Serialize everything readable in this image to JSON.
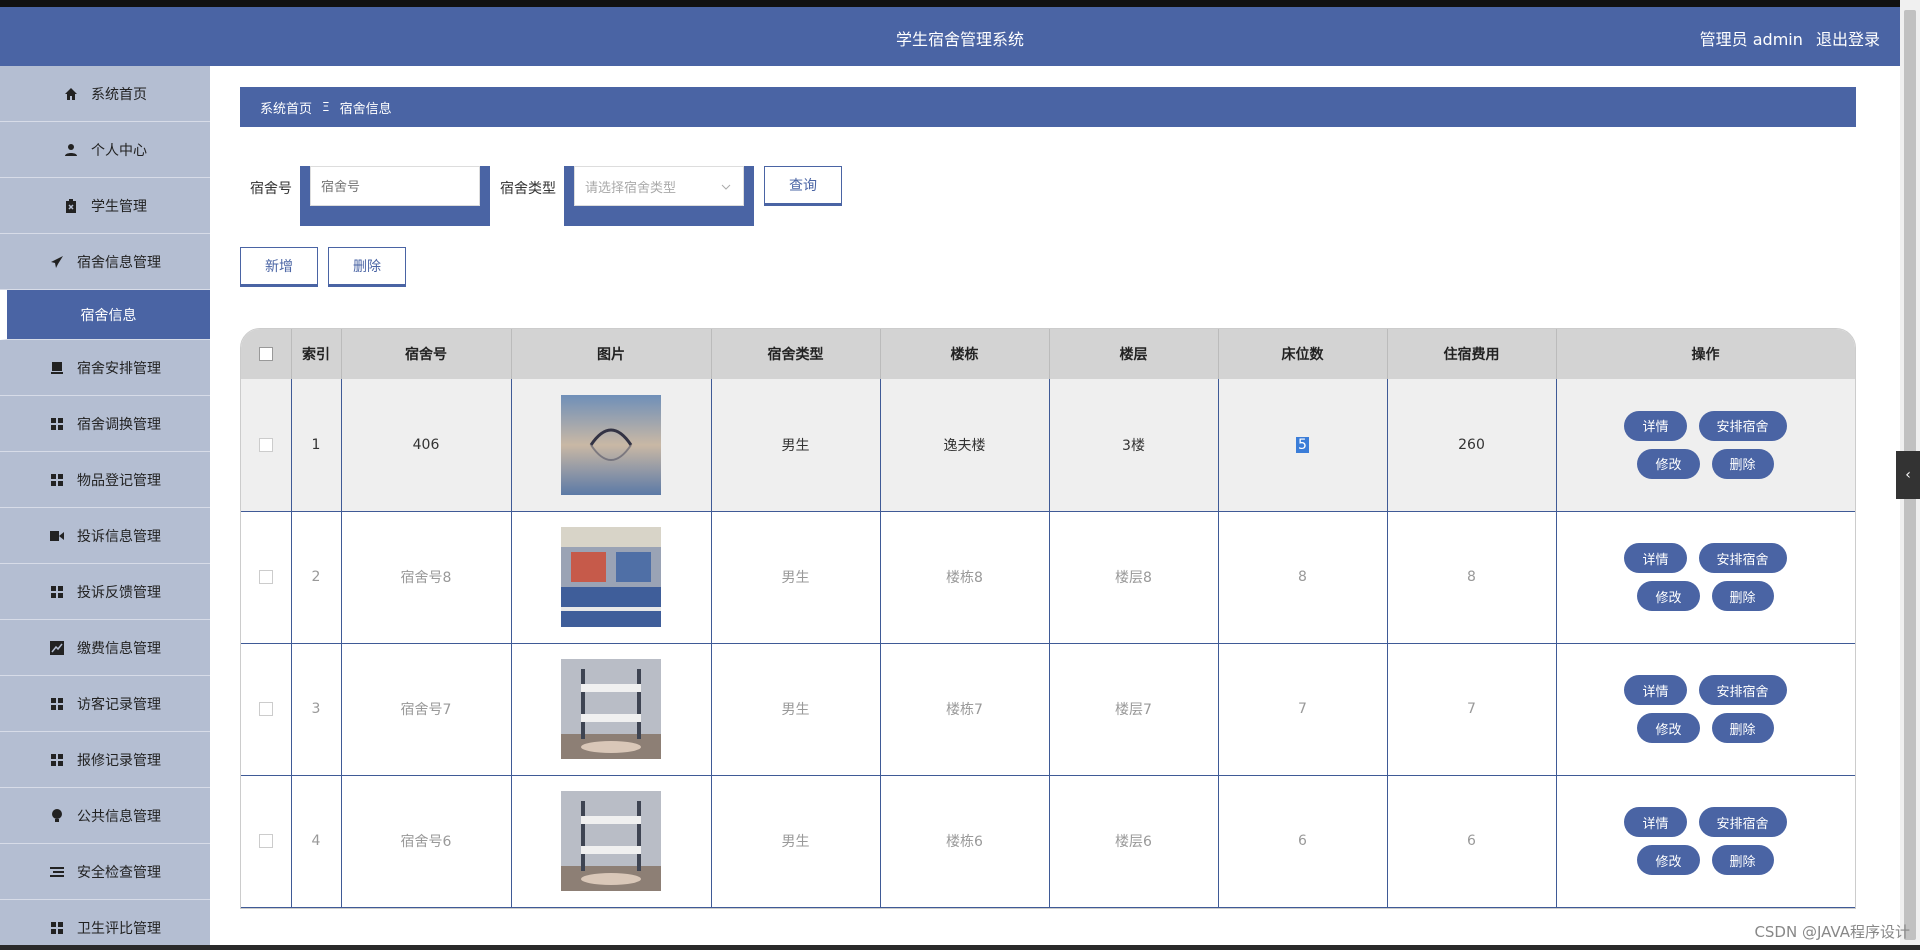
{
  "header": {
    "title": "学生宿舍管理系统",
    "user_label": "管理员 admin",
    "logout_label": "退出登录"
  },
  "sidebar": {
    "items": [
      {
        "label": "系统首页",
        "icon": "home-icon"
      },
      {
        "label": "个人中心",
        "icon": "user-icon"
      },
      {
        "label": "学生管理",
        "icon": "clipboard-icon"
      },
      {
        "label": "宿舍信息管理",
        "icon": "send-icon"
      },
      {
        "label": "宿舍信息",
        "icon": "",
        "sub": true
      },
      {
        "label": "宿舍安排管理",
        "icon": "monitor-icon"
      },
      {
        "label": "宿舍调换管理",
        "icon": "grid-icon"
      },
      {
        "label": "物品登记管理",
        "icon": "grid-icon"
      },
      {
        "label": "投诉信息管理",
        "icon": "video-icon"
      },
      {
        "label": "投诉反馈管理",
        "icon": "grid-icon"
      },
      {
        "label": "缴费信息管理",
        "icon": "chart-icon"
      },
      {
        "label": "访客记录管理",
        "icon": "grid-icon"
      },
      {
        "label": "报修记录管理",
        "icon": "grid-icon"
      },
      {
        "label": "公共信息管理",
        "icon": "bulb-icon"
      },
      {
        "label": "安全检查管理",
        "icon": "list-icon"
      },
      {
        "label": "卫生评比管理",
        "icon": "grid-icon"
      }
    ]
  },
  "breadcrumb": {
    "home": "系统首页",
    "separator": "Ξ",
    "current": "宿舍信息"
  },
  "search": {
    "room_label": "宿舍号",
    "room_placeholder": "宿舍号",
    "type_label": "宿舍类型",
    "type_placeholder": "请选择宿舍类型",
    "query_label": "查询"
  },
  "actions": {
    "add_label": "新增",
    "delete_label": "删除"
  },
  "table": {
    "columns": [
      "索引",
      "宿舍号",
      "图片",
      "宿舍类型",
      "楼栋",
      "楼层",
      "床位数",
      "住宿费用",
      "操作"
    ],
    "rows": [
      {
        "index": "1",
        "room": "406",
        "type": "男生",
        "building": "逸夫楼",
        "floor": "3楼",
        "beds": "5",
        "fee": "260"
      },
      {
        "index": "2",
        "room": "宿舍号8",
        "type": "男生",
        "building": "楼栋8",
        "floor": "楼层8",
        "beds": "8",
        "fee": "8"
      },
      {
        "index": "3",
        "room": "宿舍号7",
        "type": "男生",
        "building": "楼栋7",
        "floor": "楼层7",
        "beds": "7",
        "fee": "7"
      },
      {
        "index": "4",
        "room": "宿舍号6",
        "type": "男生",
        "building": "楼栋6",
        "floor": "楼层6",
        "beds": "6",
        "fee": "6"
      }
    ],
    "ops": {
      "detail": "详情",
      "arrange": "安排宿舍",
      "edit": "修改",
      "delete": "删除"
    }
  },
  "watermark": "CSDN @JAVA程序设计",
  "colors": {
    "primary": "#4a64a4",
    "sidebar": "#b4bed2",
    "header_row": "#d3d3d3"
  }
}
